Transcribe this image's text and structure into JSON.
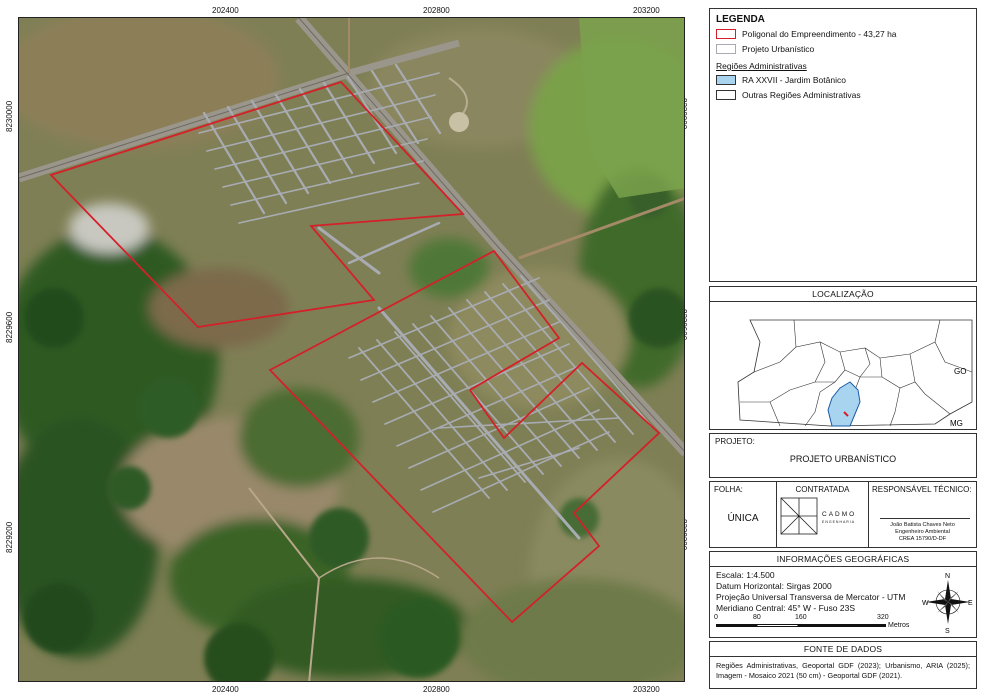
{
  "map": {
    "top_ticks": [
      "202400",
      "202800",
      "203200"
    ],
    "bottom_ticks": [
      "202400",
      "202800",
      "203200"
    ],
    "left_ticks": [
      "8230000",
      "8229600",
      "8229200"
    ],
    "right_ticks": [
      "8230000",
      "8229600",
      "8229200"
    ],
    "colors": {
      "polygon": "#d4202a",
      "urban_plan": "#a8acb2",
      "vegetation_dark": "#2d5a22",
      "vegetation_mid": "#5d7a3a",
      "savanna": "#8b8a5c",
      "field": "#9aaa6a",
      "road": "#8e8a80"
    }
  },
  "legend": {
    "title": "LEGENDA",
    "items": [
      {
        "label": "Poligonal do Empreendimento - 43,27 ha",
        "fill": "#ffffff",
        "stroke": "#d4202a"
      },
      {
        "label": "Projeto Urbanístico",
        "fill": "#ffffff",
        "stroke": "#a8acb2"
      }
    ],
    "regions_title": "Regiões Administrativas",
    "region_items": [
      {
        "label": "RA XXVII - Jardim Botânico",
        "fill": "#a9d4ef",
        "stroke": "#333333"
      },
      {
        "label": "Outras Regiões Administrativas",
        "fill": "#ffffff",
        "stroke": "#333333"
      }
    ]
  },
  "location": {
    "title": "LOCALIZAÇÃO",
    "label_go": "GO",
    "label_mg": "MG",
    "ra_color": "#a9d4ef"
  },
  "project": {
    "label": "PROJETO:",
    "value": "PROJETO URBANÍSTICO"
  },
  "sheet": {
    "label": "FOLHA:",
    "value": "ÚNICA"
  },
  "contractor": {
    "label": "CONTRATADA",
    "brand": "CADMO",
    "brand_sub": "ENGENHARIA"
  },
  "technician": {
    "label": "RESPONSÁVEL TÉCNICO:",
    "name": "João Batista Chaves Neto",
    "title": "Engenheiro Ambiental",
    "registration": "CREA 15790/D-DF"
  },
  "geo_info": {
    "title": "INFORMAÇÕES GEOGRÁFICAS",
    "lines": [
      "Escala: 1:4.500",
      "Datum Horizontal: Sirgas 2000",
      "Projeção Universal Transversa de Mercator - UTM",
      "Meridiano Central: 45° W -  Fuso 23S"
    ],
    "scale_ticks": [
      "0",
      "80",
      "160",
      "320"
    ],
    "scale_unit": "Metros",
    "compass": {
      "n": "N",
      "s": "S",
      "e": "E",
      "w": "W"
    }
  },
  "sources": {
    "title": "FONTE DE DADOS",
    "text": "Regiões Administrativas, Geoportal GDF (2023); Urbanismo, ARIA (2025); Imagem - Mosaico 2021 (50 cm) - Geoportal GDF (2021)."
  }
}
